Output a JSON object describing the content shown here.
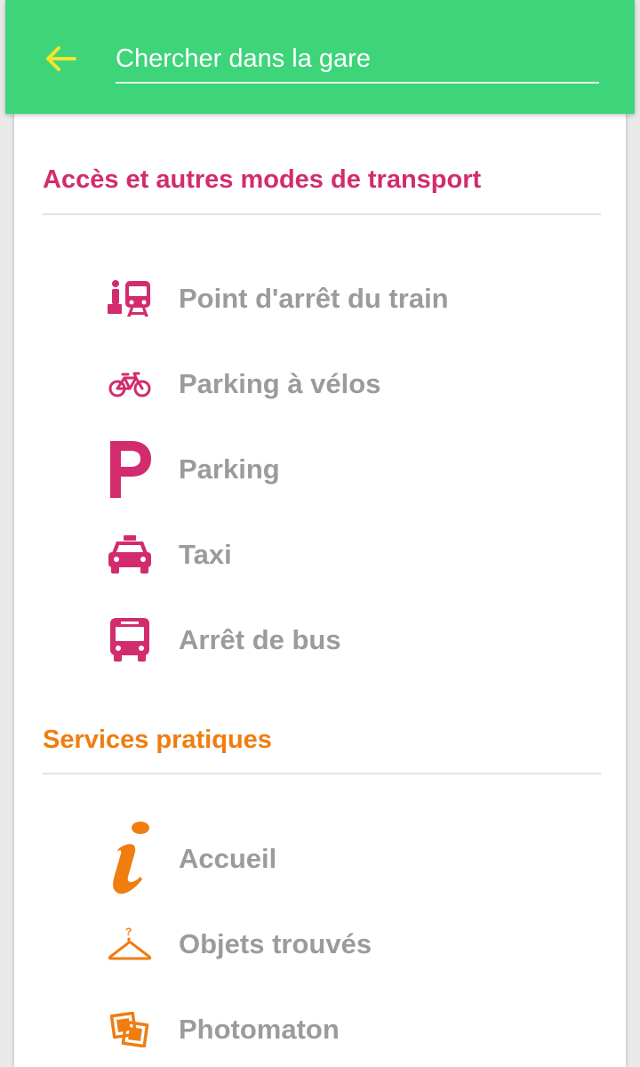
{
  "header": {
    "search_placeholder": "Chercher dans la gare",
    "back_icon": "arrow-left-icon",
    "bar_color": "#3ed47a",
    "back_icon_color": "#f3e62a"
  },
  "sections": [
    {
      "title": "Accès et autres modes de transport",
      "color": "#d22c6e",
      "items": [
        {
          "label": "Point d'arrêt du train",
          "icon": "train-stop-icon"
        },
        {
          "label": "Parking à vélos",
          "icon": "bicycle-icon"
        },
        {
          "label": "Parking",
          "icon": "parking-icon"
        },
        {
          "label": "Taxi",
          "icon": "taxi-icon"
        },
        {
          "label": "Arrêt de bus",
          "icon": "bus-icon"
        }
      ]
    },
    {
      "title": "Services pratiques",
      "color": "#ef7d10",
      "items": [
        {
          "label": "Accueil",
          "icon": "info-icon"
        },
        {
          "label": "Objets trouvés",
          "icon": "hanger-icon"
        },
        {
          "label": "Photomaton",
          "icon": "photo-booth-icon"
        }
      ]
    }
  ]
}
